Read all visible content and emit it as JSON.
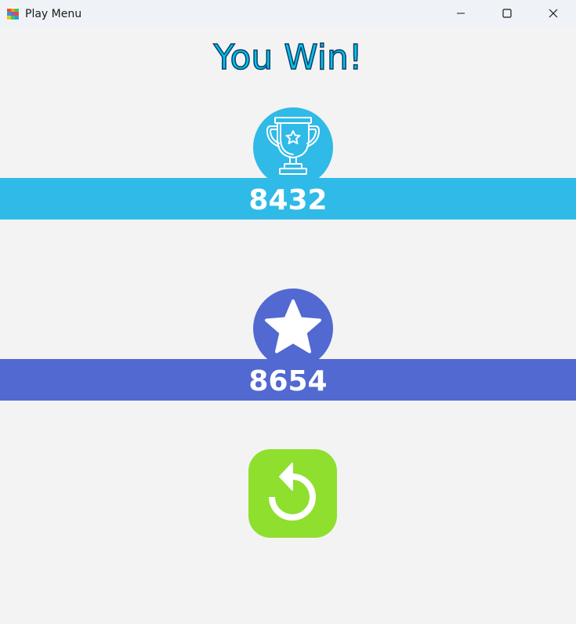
{
  "window": {
    "title": "Play Menu",
    "icon": "grid-app-icon",
    "controls": {
      "minimize": "minimize-icon",
      "maximize": "maximize-icon",
      "close": "close-icon"
    }
  },
  "result": {
    "headline": "You Win!"
  },
  "score": {
    "icon": "trophy-icon",
    "value": "8432",
    "color": "#2fbae7"
  },
  "best": {
    "icon": "star-icon",
    "value": "8654",
    "color": "#5269d1"
  },
  "replay": {
    "icon": "replay-icon",
    "color": "#8fdf2f"
  },
  "colors": {
    "headline": "#00c2f0",
    "headline_outline": "#0a3f63",
    "background": "#f3f3f3"
  }
}
